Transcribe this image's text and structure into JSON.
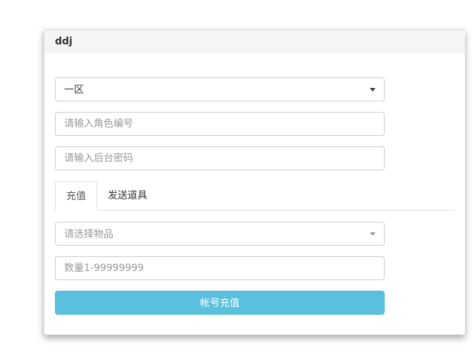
{
  "panel": {
    "title": "ddj"
  },
  "form": {
    "zone_select": {
      "value": "一区"
    },
    "role_id": {
      "placeholder": "请输入角色编号"
    },
    "admin_password": {
      "placeholder": "请输入后台密码"
    }
  },
  "tabs": [
    {
      "label": "充值",
      "active": true
    },
    {
      "label": "发送道具",
      "active": false
    }
  ],
  "recharge": {
    "item_select": {
      "placeholder": "请选择物品"
    },
    "quantity": {
      "placeholder": "数量1-99999999"
    },
    "submit_label": "帐号充值"
  },
  "colors": {
    "button_bg": "#5bc0de",
    "header_bg": "#f5f5f5",
    "border": "#cccccc"
  }
}
